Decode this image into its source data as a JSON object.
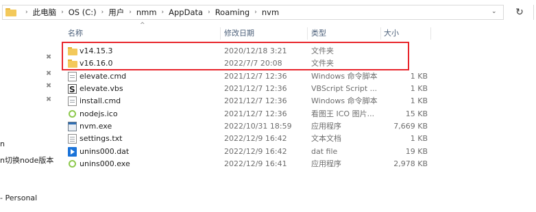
{
  "breadcrumb": [
    "此电脑",
    "OS (C:)",
    "用户",
    "nmm",
    "AppData",
    "Roaming",
    "nvm"
  ],
  "nav_fragments": [
    {
      "label": "n"
    },
    {
      "label": "n切换node版本"
    },
    {
      "label": "- Personal"
    }
  ],
  "columns": {
    "name": "名称",
    "date": "修改日期",
    "type": "类型",
    "size": "大小"
  },
  "files": [
    {
      "icon": "folder-icon",
      "name": "v14.15.3",
      "date": "2020/12/18 3:21",
      "type": "文件夹",
      "size": ""
    },
    {
      "icon": "folder-icon",
      "name": "v16.16.0",
      "date": "2022/7/7 20:08",
      "type": "文件夹",
      "size": ""
    },
    {
      "icon": "cmd-file-icon",
      "name": "elevate.cmd",
      "date": "2021/12/7 12:36",
      "type": "Windows 命令脚本",
      "size": "1 KB"
    },
    {
      "icon": "vbs-script-icon",
      "name": "elevate.vbs",
      "date": "2021/12/7 12:36",
      "type": "VBScript Script ...",
      "size": "1 KB"
    },
    {
      "icon": "cmd-file-icon",
      "name": "install.cmd",
      "date": "2021/12/7 12:36",
      "type": "Windows 命令脚本",
      "size": "1 KB"
    },
    {
      "icon": "nodejs-icon",
      "name": "nodejs.ico",
      "date": "2021/12/7 12:36",
      "type": "看图王 ICO 图片...",
      "size": "15 KB"
    },
    {
      "icon": "exe-icon",
      "name": "nvm.exe",
      "date": "2022/10/31 18:59",
      "type": "应用程序",
      "size": "7,669 KB"
    },
    {
      "icon": "text-file-icon",
      "name": "settings.txt",
      "date": "2022/12/9 16:42",
      "type": "文本文档",
      "size": "1 KB"
    },
    {
      "icon": "dat-file-icon",
      "name": "unins000.dat",
      "date": "2022/12/9 16:42",
      "type": "dat file",
      "size": "19 KB"
    },
    {
      "icon": "nodejs-icon",
      "name": "unins000.exe",
      "date": "2022/12/9 16:41",
      "type": "应用程序",
      "size": "2,978 KB"
    }
  ],
  "colors": {
    "highlight": "#e8242a",
    "folder": "#f3c95b"
  }
}
